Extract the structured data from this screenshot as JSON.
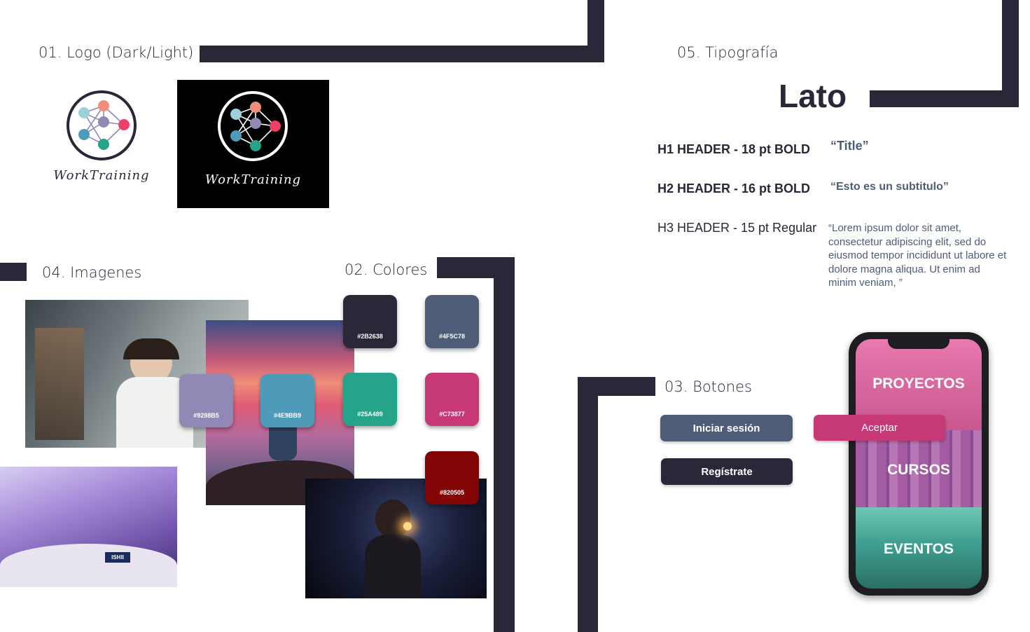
{
  "sections": {
    "logo": "01. Logo (Dark/Light)",
    "colors": "02. Colores",
    "buttons": "03. Botones",
    "images": "04. Imagenes",
    "typography": "05. Tipografía"
  },
  "brand": {
    "name": "WorkTraining"
  },
  "palette": [
    {
      "hex": "#2B2638",
      "label": "#2B2638"
    },
    {
      "hex": "#4F5C78",
      "label": "#4F5C78"
    },
    {
      "hex": "#25A489",
      "label": "#25A489"
    },
    {
      "hex": "#C73877",
      "label": "#C73877"
    },
    {
      "hex": "#820505",
      "label": "#820505"
    },
    {
      "hex": "#9288B5",
      "label": "#9288B5"
    },
    {
      "hex": "#4E9BB9",
      "label": "#4E9BB9"
    }
  ],
  "typography": {
    "font": "Lato",
    "rows": [
      {
        "label": "H1 HEADER - 18 pt BOLD",
        "sample": "“Title”"
      },
      {
        "label": "H2 HEADER - 16 pt BOLD",
        "sample": "“Esto es un subtitulo”"
      },
      {
        "label": "H3 HEADER - 15 pt Regular",
        "sample": "“Lorem ipsum dolor sit amet, consectetur adipiscing elit, sed do eiusmod tempor incididunt ut labore et dolore magna aliqua. Ut enim ad minim veniam, ”"
      }
    ]
  },
  "buttons": {
    "login": "Iniciar sesión",
    "accept": "Aceptar",
    "register": "Regístrate"
  },
  "phone": {
    "tiles": [
      "PROYECTOS",
      "CURSOS",
      "EVENTOS"
    ]
  },
  "photos": {
    "badge": "ISHII"
  }
}
